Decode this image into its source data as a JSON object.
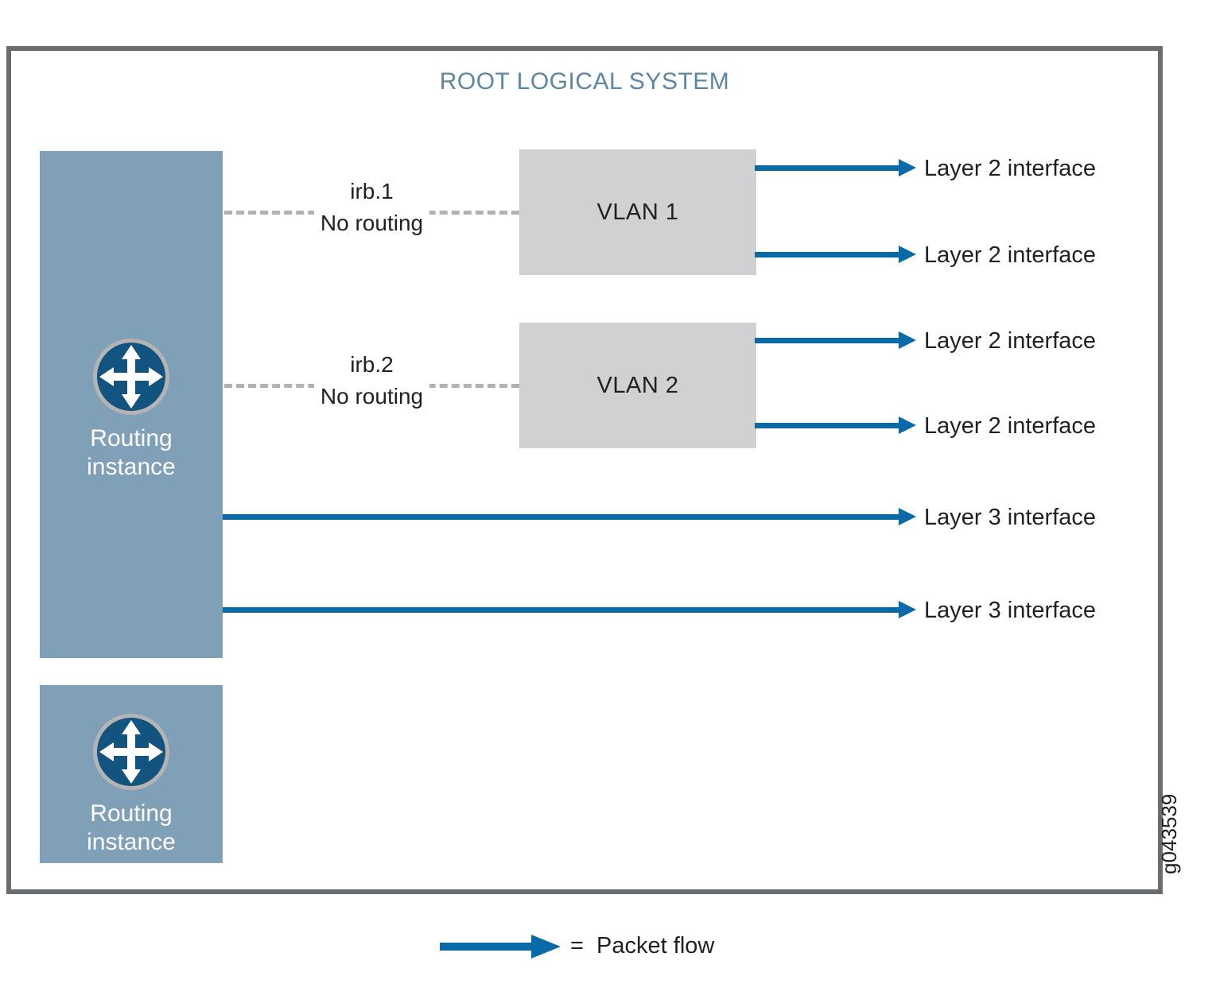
{
  "figure": {
    "id_label": "g043539",
    "title": "ROOT LOGICAL SYSTEM"
  },
  "colors": {
    "frame_border": "#6a6d70",
    "title_text": "#5b87a3",
    "routing_block": "#7fa0b7",
    "vlan_box": "#d0d1d2",
    "packet_flow": "#0a6aa8",
    "irb_dash": "#b0b2b4",
    "router_icon_fill": "#13537f",
    "router_icon_ring": "#b4b4b4"
  },
  "routing_instances": [
    {
      "label": "Routing\ninstance",
      "icon": "router-icon"
    },
    {
      "label": "Routing\ninstance",
      "icon": "router-icon"
    }
  ],
  "irb_links": [
    {
      "name": "irb.1",
      "sub": "No routing"
    },
    {
      "name": "irb.2",
      "sub": "No routing"
    }
  ],
  "vlans": [
    {
      "label": "VLAN 1"
    },
    {
      "label": "VLAN 2"
    }
  ],
  "interfaces": [
    {
      "label": "Layer 2 interface",
      "source": "vlan-1"
    },
    {
      "label": "Layer 2 interface",
      "source": "vlan-1"
    },
    {
      "label": "Layer 2 interface",
      "source": "vlan-2"
    },
    {
      "label": "Layer 2 interface",
      "source": "vlan-2"
    },
    {
      "label": "Layer 3 interface",
      "source": "routing-instance-1"
    },
    {
      "label": "Layer 3 interface",
      "source": "routing-instance-1"
    }
  ],
  "legend": {
    "text": "=  Packet flow"
  }
}
